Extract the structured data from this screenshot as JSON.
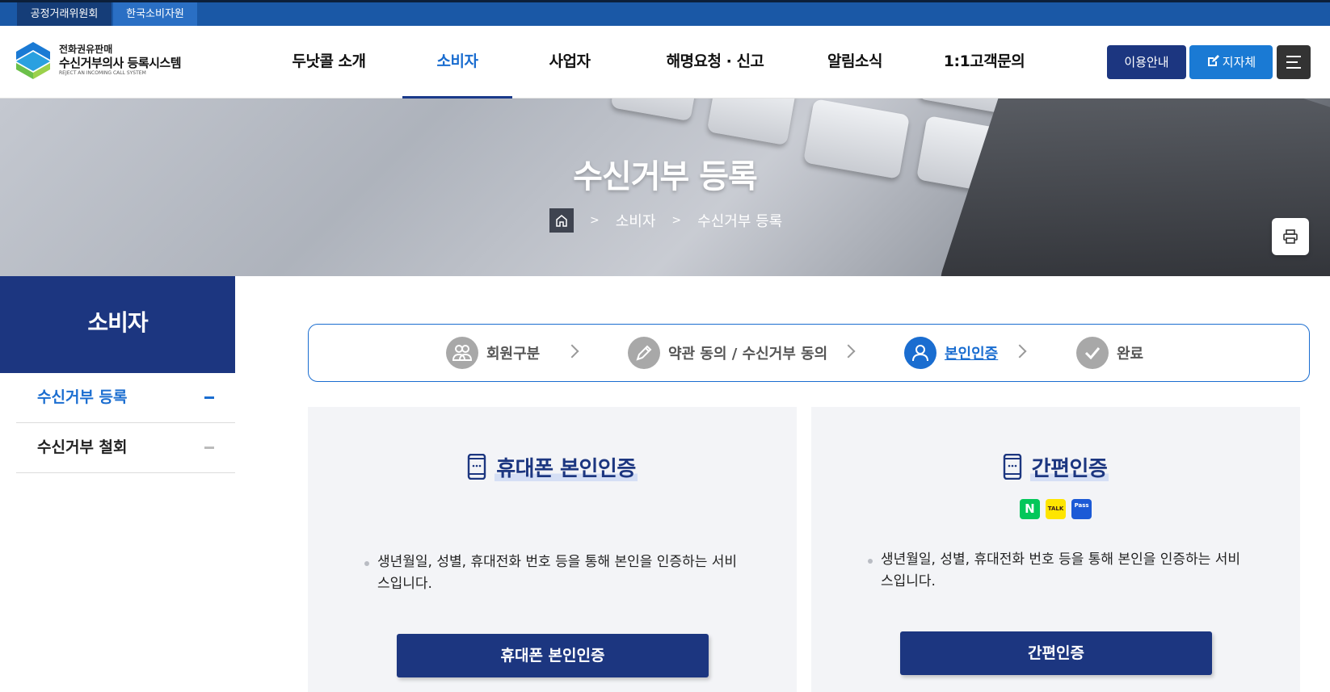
{
  "topbar": {
    "site1": "공정거래위원회",
    "site2": "한국소비자원"
  },
  "logo": {
    "line1": "전화권유판매",
    "line2": "수신거부의사 등록시스템",
    "line3": "REJECT AN INCOMING CALL SYSTEM"
  },
  "nav": {
    "items": [
      "두낫콜 소개",
      "소비자",
      "사업자",
      "해명요청 · 신고",
      "알림소식",
      "1:1고객문의"
    ],
    "active": "소비자"
  },
  "header_buttons": {
    "guide": "이용안내",
    "local": "지자체"
  },
  "hero": {
    "title": "수신거부 등록",
    "breadcrumb": [
      "소비자",
      "수신거부 등록"
    ]
  },
  "sidebar": {
    "title": "소비자",
    "items": [
      {
        "label": "수신거부 등록",
        "active": true
      },
      {
        "label": "수신거부 철회",
        "active": false
      }
    ]
  },
  "steps": {
    "items": [
      "회원구분",
      "약관 동의 / 수신거부 동의",
      "본인인증",
      "완료"
    ],
    "active": "본인인증"
  },
  "cards": {
    "phone": {
      "title": "휴대폰 본인인증",
      "desc": "생년월일, 성별, 휴대전화 번호 등을 통해 본인을 인증하는 서비스입니다.",
      "button": "휴대폰 본인인증"
    },
    "simple": {
      "title": "간편인증",
      "badges": [
        "N",
        "TALK",
        "Pass"
      ],
      "desc": "생년월일, 성별, 휴대전화 번호 등을 통해 본인을 인증하는 서비스입니다.",
      "button": "간편인증"
    }
  },
  "colors": {
    "primary_navy": "#1c3680",
    "accent_blue": "#1a6dd0",
    "topbar_blue": "#1a58a6"
  }
}
